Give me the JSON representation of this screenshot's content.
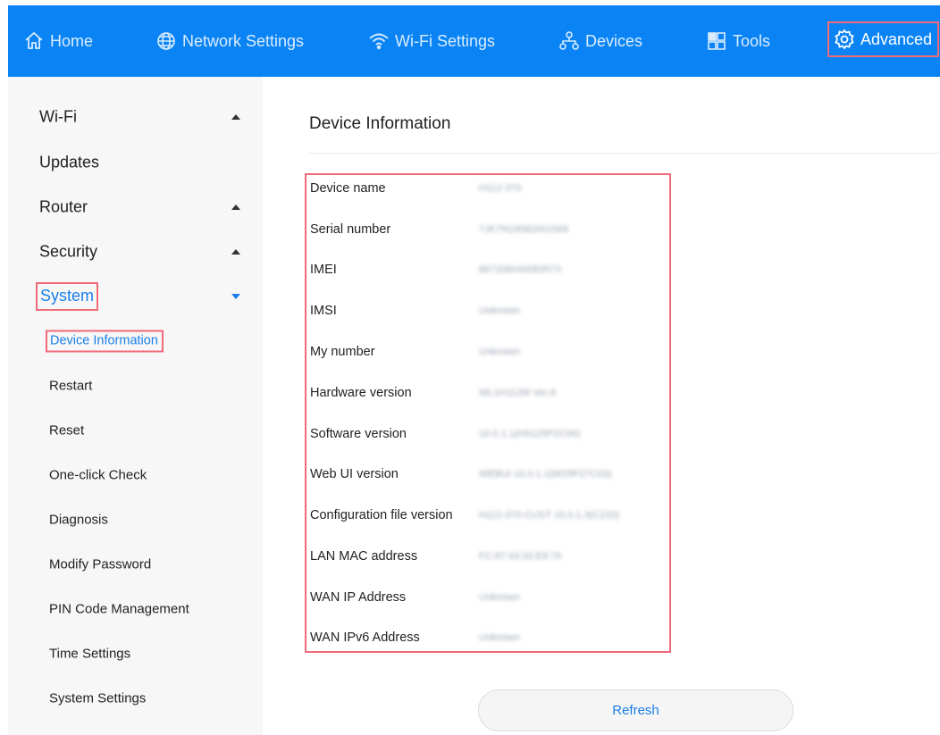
{
  "topnav": {
    "items": [
      {
        "label": "Home",
        "icon": "home-icon"
      },
      {
        "label": "Network Settings",
        "icon": "globe-icon"
      },
      {
        "label": "Wi-Fi Settings",
        "icon": "wifi-icon"
      },
      {
        "label": "Devices",
        "icon": "devices-icon"
      },
      {
        "label": "Tools",
        "icon": "tools-icon"
      },
      {
        "label": "Advanced",
        "icon": "gear-icon",
        "active": true
      }
    ]
  },
  "sidebar": {
    "items": [
      {
        "label": "Wi-Fi",
        "expanded": false
      },
      {
        "label": "Updates"
      },
      {
        "label": "Router",
        "expanded": false
      },
      {
        "label": "Security",
        "expanded": false
      },
      {
        "label": "System",
        "expanded": true,
        "active": true
      }
    ],
    "system_subitems": [
      {
        "label": "Device Information",
        "active": true
      },
      {
        "label": "Restart"
      },
      {
        "label": "Reset"
      },
      {
        "label": "One-click Check"
      },
      {
        "label": "Diagnosis"
      },
      {
        "label": "Modify Password"
      },
      {
        "label": "PIN Code Management"
      },
      {
        "label": "Time Settings"
      },
      {
        "label": "System Settings"
      }
    ]
  },
  "main": {
    "title": "Device Information",
    "rows": [
      {
        "label": "Device name",
        "value": "H112-370"
      },
      {
        "label": "Serial number",
        "value": "7JK7N19582001566"
      },
      {
        "label": "IMEI",
        "value": "867206040083573"
      },
      {
        "label": "IMSI",
        "value": "Unknown"
      },
      {
        "label": "My number",
        "value": "Unknown"
      },
      {
        "label": "Hardware version",
        "value": "WL1H112M Ver.A"
      },
      {
        "label": "Software version",
        "value": "10.0.1.1(H0125P2C00)"
      },
      {
        "label": "Web UI version",
        "value": "WEBUI 10.0.1.1(W29P27C03)"
      },
      {
        "label": "Configuration file version",
        "value": "H112-370-CUST 10.0.1.3(C233)"
      },
      {
        "label": "LAN MAC address",
        "value": "FC:87:43:33:E9:76"
      },
      {
        "label": "WAN IP Address",
        "value": "Unknown"
      },
      {
        "label": "WAN IPv6 Address",
        "value": "Unknown"
      }
    ],
    "refresh_label": "Refresh"
  },
  "colors": {
    "nav_bg": "#0a84f5",
    "accent": "#1a7fe8",
    "highlight_border": "#f06a7a",
    "sidebar_bg": "#f7f7f7"
  }
}
